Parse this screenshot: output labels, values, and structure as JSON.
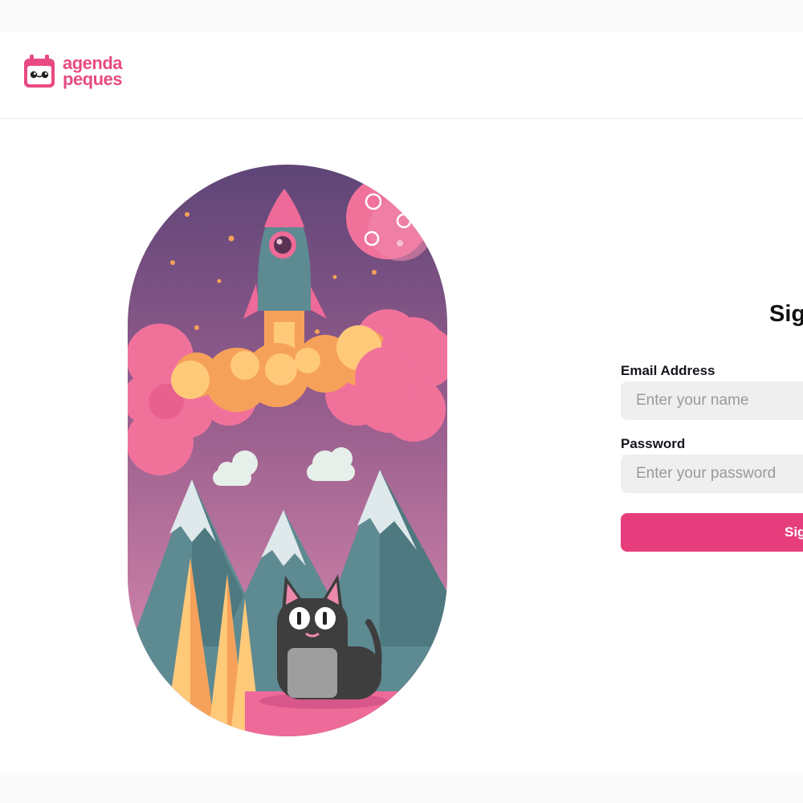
{
  "brand": {
    "line1": "agenda",
    "line2": "peques",
    "color": "#e84a83"
  },
  "form": {
    "title": "Sig",
    "email_label": "Email Address",
    "email_placeholder": "Enter your name",
    "password_label": "Password",
    "password_placeholder": "Enter your password",
    "submit_label": "Sig",
    "accent": "#e63e7c"
  },
  "illustration": {
    "subject": "rocket launch over mountains with black cat",
    "palette": {
      "sky_top": "#5e4577",
      "sky_bottom": "#e08fb0",
      "clouds": "#f0729b",
      "mountains": "#5e8a92"
    }
  }
}
